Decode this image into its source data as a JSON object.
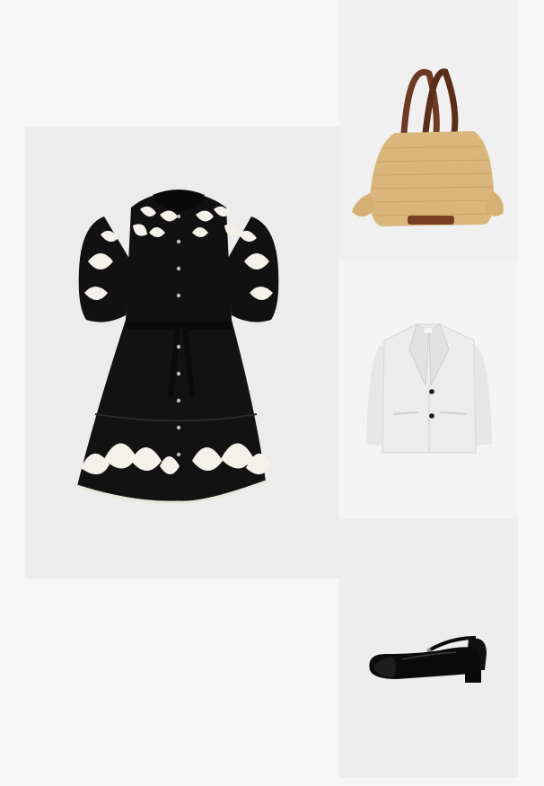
{
  "items": [
    {
      "id": "dress",
      "icon": "dress-icon",
      "colors": {
        "primary": "#0d0d0d",
        "accent": "#f4f1ea"
      }
    },
    {
      "id": "bag",
      "icon": "tote-bag-icon",
      "colors": {
        "primary": "#d9b77c",
        "accent": "#6e3b22"
      }
    },
    {
      "id": "blazer",
      "icon": "blazer-icon",
      "colors": {
        "primary": "#ebebeb",
        "accent": "#1a1a1a"
      }
    },
    {
      "id": "shoes",
      "icon": "mary-jane-shoe-icon",
      "colors": {
        "primary": "#0b0b0b"
      }
    }
  ],
  "colors": {
    "page_background": "#f6f6f6",
    "tile_background": "#ececec"
  }
}
